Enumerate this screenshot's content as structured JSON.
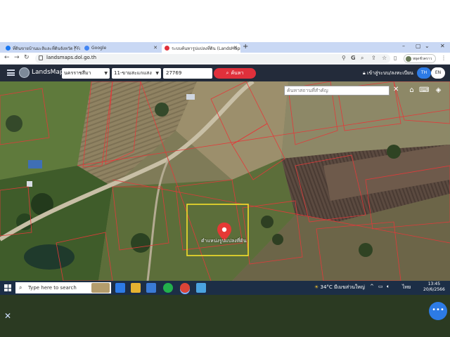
{
  "browser": {
    "tabs": [
      {
        "title": "ที่ดินขายบ้านมะลิและที่ดินจังหวัด | Facebook",
        "favicon_color": "#1877f2"
      },
      {
        "title": "Google",
        "favicon_color": "#4285f4"
      },
      {
        "title": "ระบบค้นหารูปแปลงที่ดิน (LandsMaps)",
        "favicon_color": "#e0303b"
      }
    ],
    "new_tab_label": "+",
    "url": "landsmaps.dol.go.th",
    "profile_label": "หยุดชั่วคราว"
  },
  "app": {
    "brand": "LandsMaps",
    "province": "นครราชสีมา",
    "district": "11-ขามสะแกแสง",
    "parcel_number": "27769",
    "search_label": "ค้นหา",
    "login_label": "เข้าสู่ระบบ/ลงทะเบียน",
    "lang_th": "TH",
    "lang_en": "EN"
  },
  "map": {
    "place_search_placeholder": "ค้นหาสถานที่สำคัญ",
    "pin_label": "ตำแหน่งรูปแปลงที่ดิน",
    "highlight_color": "#f4e02a",
    "pin_color": "#e53935",
    "parcel_line_color": "#e23a3a"
  },
  "taskbar": {
    "search_placeholder": "Type here to search",
    "weather": "34°C",
    "weather_desc": "มีเมฆส่วนใหญ่",
    "lang_indicator": "ไทย",
    "time": "13:45",
    "date": "20/6/2566"
  }
}
